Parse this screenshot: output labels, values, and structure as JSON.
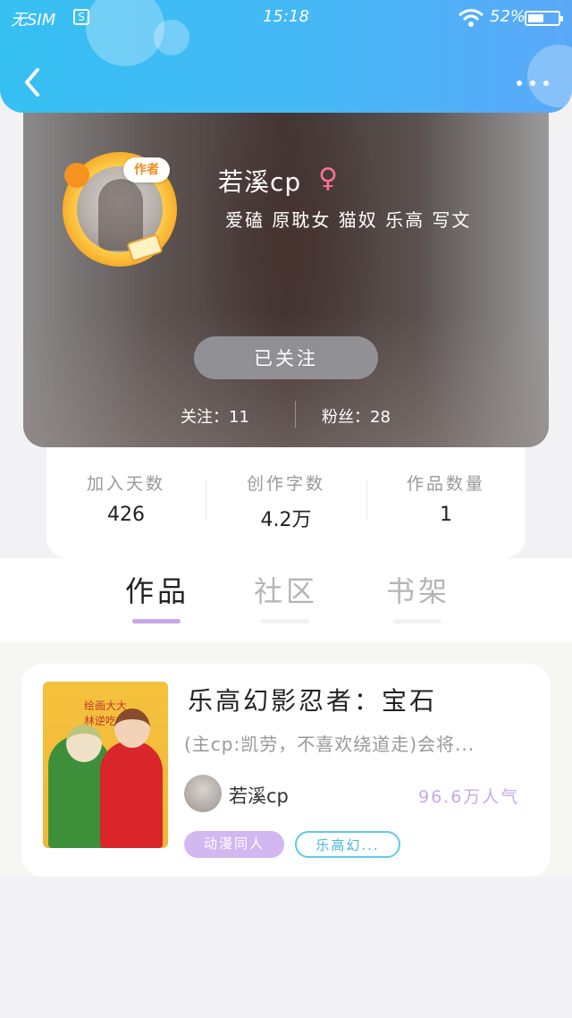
{
  "status_bar": {
    "sim": "无SIM",
    "s_icon": "S",
    "time": "15:18",
    "battery": "52%",
    "battery_level": 0.52
  },
  "nav": {
    "back_icon": "chevron-left-icon",
    "more_icon": "more-dots-icon"
  },
  "profile": {
    "nickname": "若溪cp",
    "gender_symbol": "♀",
    "author_badge": "作者",
    "tags": "爱磕 原耽女 猫奴 乐高 写文",
    "follow_button": "已关注",
    "following_label": "关注：11",
    "fans_label": "粉丝：28"
  },
  "stats": [
    {
      "label": "加入天数",
      "value": "426"
    },
    {
      "label": "创作字数",
      "value": "4.2万"
    },
    {
      "label": "作品数量",
      "value": "1"
    }
  ],
  "tabs": [
    {
      "label": "作品",
      "active": true
    },
    {
      "label": "社区",
      "active": false
    },
    {
      "label": "书架",
      "active": false
    }
  ],
  "work": {
    "cover_text": "绘画大大\n林逆吃林",
    "title": "乐高幻影忍者：宝石",
    "description": "(主cp:凯劳，不喜欢绕道走)会将...",
    "author": "若溪cp",
    "popularity": "96.6万人气",
    "tags": [
      "动漫同人",
      "乐高幻..."
    ]
  },
  "colors": {
    "header_start": "#36c0f2",
    "header_end": "#5aa9f8",
    "tab_active_indicator": "#c7a6ee",
    "tag_purple_bg": "#d3b7f1",
    "tag_cyan_border": "#5fcbe8",
    "popularity": "#c8a8ec",
    "gender": "#ff6f9c"
  }
}
